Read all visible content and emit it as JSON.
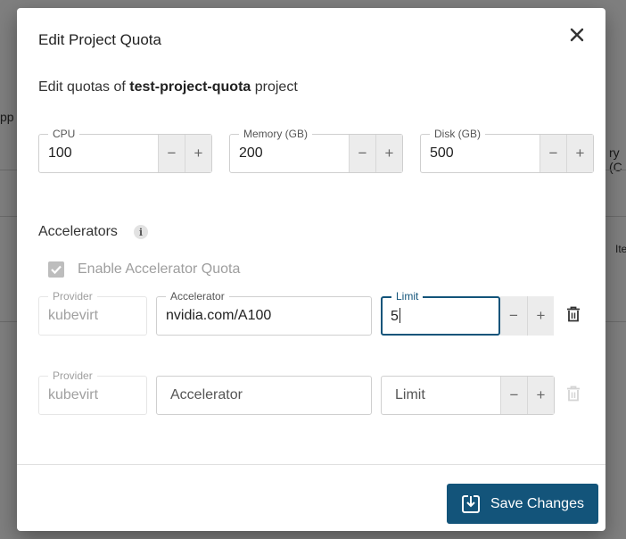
{
  "background": {
    "frag_left": "pp",
    "frag_right": "ry (C",
    "frag_right2": "Ite"
  },
  "dialog": {
    "title": "Edit Project Quota",
    "subtitle_prefix": "Edit quotas of ",
    "project_name": "test-project-quota",
    "subtitle_suffix": " project"
  },
  "quotas": {
    "cpu": {
      "label": "CPU",
      "value": "100"
    },
    "memory": {
      "label": "Memory (GB)",
      "value": "200"
    },
    "disk": {
      "label": "Disk (GB)",
      "value": "500"
    },
    "minus": "−",
    "plus": "+"
  },
  "accelerators": {
    "heading": "Accelerators",
    "info": "i",
    "enable_label": "Enable Accelerator Quota",
    "enabled": true,
    "rows": [
      {
        "provider_label": "Provider",
        "provider": "kubevirt",
        "accelerator_label": "Accelerator",
        "accelerator": "nvidia.com/A100",
        "limit_label": "Limit",
        "limit": "5"
      },
      {
        "provider_label": "Provider",
        "provider": "kubevirt",
        "accelerator_placeholder": "Accelerator",
        "limit_placeholder": "Limit"
      }
    ]
  },
  "footer": {
    "save_label": "Save Changes"
  },
  "colors": {
    "primary": "#13547a"
  }
}
